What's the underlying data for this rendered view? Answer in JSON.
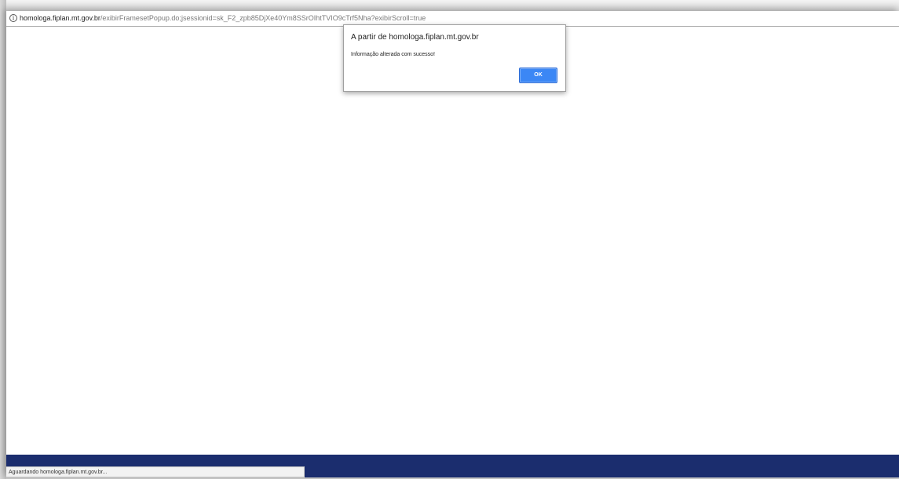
{
  "addressbar": {
    "host": "homologa.fiplan.mt.gov.br",
    "path": "/exibirFramesetPopup.do;jsessionid=sk_F2_zpb85DjXe40Ym8SSrOIhtTVIO9cTrf5Nha?exibirScroll=true",
    "icon": "info-icon"
  },
  "dialog": {
    "title": "A partir de homologa.fiplan.mt.gov.br",
    "message": "Informação alterada com sucesso!",
    "ok_label": "OK"
  },
  "statusbar": {
    "text": "Aguardando homologa.fiplan.mt.gov.br..."
  },
  "colors": {
    "footer_bar": "#1b2d6e",
    "ok_button": "#3b87f5"
  }
}
